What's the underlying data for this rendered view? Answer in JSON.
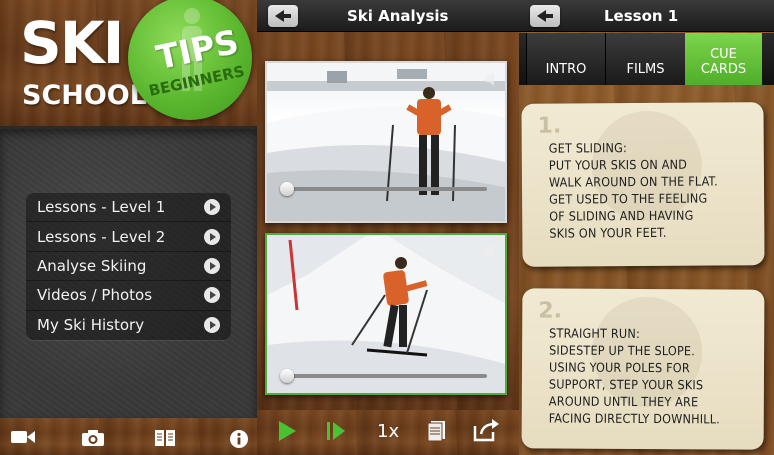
{
  "logo": {
    "line1": "SKI",
    "line2": "SCHOOL"
  },
  "badge": {
    "title": "TIPS",
    "subtitle": "BEGINNERS"
  },
  "menu": {
    "items": [
      {
        "label": "Lessons - Level 1"
      },
      {
        "label": "Lessons - Level 2"
      },
      {
        "label": "Analyse Skiing"
      },
      {
        "label": "Videos / Photos"
      },
      {
        "label": "My Ski History"
      }
    ]
  },
  "left_toolbar": {
    "icons": [
      "video-camera-icon",
      "camera-icon",
      "book-icon",
      "info-icon"
    ]
  },
  "center": {
    "title": "Ski Analysis",
    "videos": [
      {
        "name": "video-top",
        "progress": 0.0
      },
      {
        "name": "video-bottom",
        "progress": 0.0
      }
    ],
    "footer": {
      "play_icon": "play-icon",
      "step_icon": "step-forward-icon",
      "speed_label": "1x",
      "notes_icon": "notes-icon",
      "share_icon": "share-icon"
    }
  },
  "right": {
    "title": "Lesson 1",
    "tabs": [
      {
        "label": "INTRO",
        "active": false
      },
      {
        "label": "FILMS",
        "active": false
      },
      {
        "label": "CUE\nCARDS",
        "active": true
      }
    ],
    "cards": [
      {
        "number": "1.",
        "text": "GET SLIDING:\nPUT YOUR SKIS ON AND\nWALK AROUND ON THE FLAT.\nGET USED TO THE FEELING\nOF SLIDING AND HAVING\nSKIS ON YOUR FEET."
      },
      {
        "number": "2.",
        "text": "STRAIGHT RUN:\nSIDESTEP UP THE SLOPE.\nUSING YOUR POLES FOR\nSUPPORT, STEP YOUR SKIS\nAROUND UNTIL THEY ARE\nFACING DIRECTLY DOWNHILL."
      }
    ]
  },
  "colors": {
    "accent_green": "#5cb82f",
    "header_dark": "#1c1c1c",
    "card_paper": "#ede4c9"
  }
}
